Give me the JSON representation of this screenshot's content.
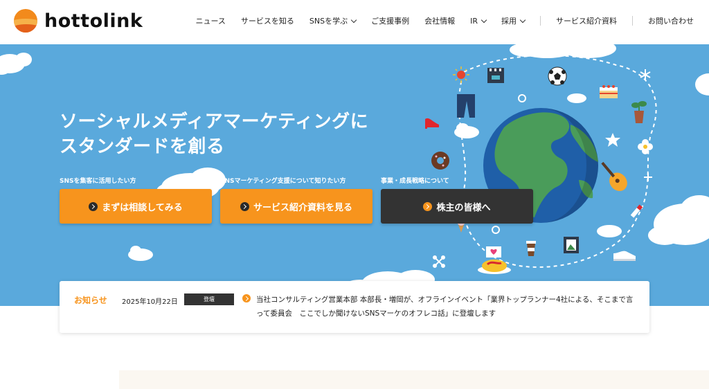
{
  "header": {
    "logo_text": "hottolink",
    "nav": [
      {
        "label": "ニュース",
        "dropdown": false
      },
      {
        "label": "サービスを知る",
        "dropdown": false
      },
      {
        "label": "SNSを学ぶ",
        "dropdown": true
      },
      {
        "label": "ご支援事例",
        "dropdown": false
      },
      {
        "label": "会社情報",
        "dropdown": false
      },
      {
        "label": "IR",
        "dropdown": true
      },
      {
        "label": "採用",
        "dropdown": true
      }
    ],
    "nav_right": [
      {
        "label": "サービス紹介資料"
      },
      {
        "label": "お問い合わせ"
      }
    ]
  },
  "hero": {
    "title_line1": "ソーシャルメディアマーケティングに",
    "title_line2": "スタンダードを創る",
    "ctas": [
      {
        "caption": "SNSを集客に活用したい方",
        "label": "まずは相談してみる"
      },
      {
        "caption": "SNSマーケティング支援について知りたい方",
        "label": "サービス紹介資料を見る"
      },
      {
        "caption": "事業・成長戦略について",
        "label": "株主の皆様へ"
      }
    ]
  },
  "news": {
    "label": "お知らせ",
    "date": "2025年10月22日",
    "tag": "登壇",
    "text": "当社コンサルティング営業本部 本部長・増岡が、オフラインイベント「業界トップランナー4社による、そこまで言って委員会　ここでしか聞けないSNSマーケのオフレコ話」に登壇します"
  },
  "colors": {
    "hero_bg": "#5aa9dc",
    "accent_orange": "#f7941d",
    "dark_button": "#333333",
    "globe_ocean": "#1f5fa8",
    "globe_land": "#4a9c5a"
  }
}
